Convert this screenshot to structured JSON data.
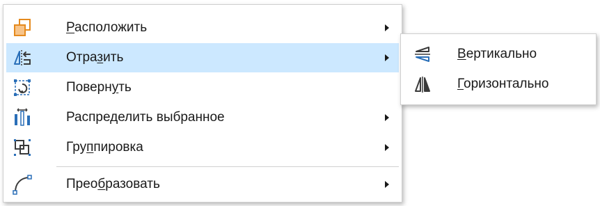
{
  "colors": {
    "highlight": "#cce8ff",
    "icon_orange": "#e58a1e",
    "icon_blue": "#2a6fb8",
    "icon_dark": "#3a3a3a"
  },
  "main_menu": {
    "items": [
      {
        "label_pre": "",
        "label_mnemonic": "Р",
        "label_post": "асположить",
        "icon": "arrange-icon",
        "has_submenu": true
      },
      {
        "label_pre": "Отра",
        "label_mnemonic": "з",
        "label_post": "ить",
        "icon": "flip-icon",
        "has_submenu": true,
        "highlighted": true
      },
      {
        "label_pre": "Поверн",
        "label_mnemonic": "у",
        "label_post": "ть",
        "icon": "rotate-icon",
        "has_submenu": false
      },
      {
        "label_pre": "Распре",
        "label_mnemonic": "д",
        "label_post": "елить выбранное",
        "icon": "distribute-icon",
        "has_submenu": true
      },
      {
        "label_pre": "Гру",
        "label_mnemonic": "п",
        "label_post": "пировка",
        "icon": "group-icon",
        "has_submenu": true
      },
      {
        "label_pre": "Прео",
        "label_mnemonic": "б",
        "label_post": "разовать",
        "icon": "convert-icon",
        "has_submenu": true
      }
    ]
  },
  "submenu": {
    "items": [
      {
        "label_pre": "",
        "label_mnemonic": "В",
        "label_post": "ертикально",
        "icon": "flip-vertical-icon"
      },
      {
        "label_pre": "",
        "label_mnemonic": "Г",
        "label_post": "оризонтально",
        "icon": "flip-horizontal-icon"
      }
    ]
  }
}
